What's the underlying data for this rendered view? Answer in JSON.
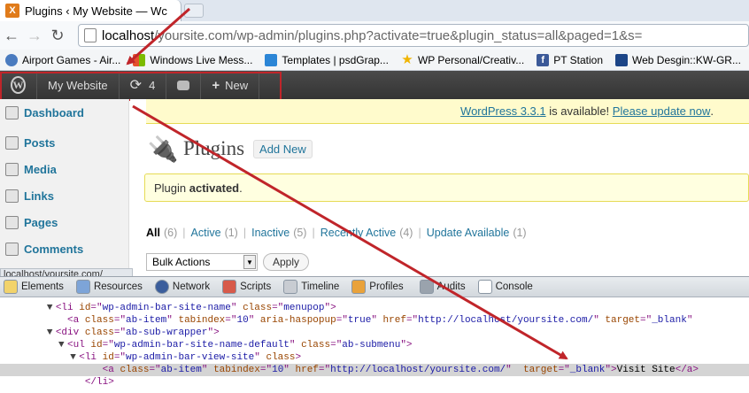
{
  "browser": {
    "tab_title": "Plugins ‹ My Website — Wc",
    "tab_favicon_glyph": "X",
    "url_host": "localhost",
    "url_path": "/yoursite.com/wp-admin/plugins.php?activate=true&plugin_status=all&paged=1&s=",
    "bookmarks": [
      {
        "label": "Airport Games - Air...",
        "icon": "globe-icon",
        "color": "#4a7bbf"
      },
      {
        "label": "Windows Live Mess...",
        "icon": "windows-icon",
        "color": "#e5512d"
      },
      {
        "label": "Templates | psdGrap...",
        "icon": "psd-icon",
        "color": "#2b85d6"
      },
      {
        "label": "WP Personal/Creativ...",
        "icon": "star-icon",
        "color": "#f0b400"
      },
      {
        "label": "PT Station",
        "icon": "facebook-icon",
        "color": "#3b5998"
      },
      {
        "label": "Web Desgin::KW-GR...",
        "icon": "kw-icon",
        "color": "#1c4587"
      }
    ],
    "status_url": "localhost/yoursite.com/"
  },
  "adminbar": {
    "site_name": "My Website",
    "updates_count": "4",
    "new_label": "New"
  },
  "sidebar": {
    "items": [
      {
        "label": "Dashboard",
        "icon": "dashboard-icon"
      },
      {
        "label": "Posts",
        "icon": "pin-icon"
      },
      {
        "label": "Media",
        "icon": "media-icon"
      },
      {
        "label": "Links",
        "icon": "link-icon"
      },
      {
        "label": "Pages",
        "icon": "pages-icon"
      },
      {
        "label": "Comments",
        "icon": "comments-icon"
      }
    ]
  },
  "content": {
    "update_link": "WordPress 3.3.1",
    "update_text": " is available! ",
    "update_now": "Please update now",
    "update_end": ".",
    "page_title": "Plugins",
    "add_new": "Add New",
    "notice_prefix": "Plugin ",
    "notice_bold": "activated",
    "notice_suffix": ".",
    "filters": [
      {
        "label": "All",
        "count": "(6)"
      },
      {
        "label": "Active",
        "count": "(1)"
      },
      {
        "label": "Inactive",
        "count": "(5)"
      },
      {
        "label": "Recently Active",
        "count": "(4)"
      },
      {
        "label": "Update Available",
        "count": "(1)"
      }
    ],
    "bulk_actions": "Bulk Actions",
    "apply": "Apply"
  },
  "devtools": {
    "tabs": [
      "Elements",
      "Resources",
      "Network",
      "Scripts",
      "Timeline",
      "Profiles",
      "Audits",
      "Console"
    ],
    "lines": [
      {
        "indent": "        ",
        "tri": "▼",
        "parts": [
          [
            "tag",
            "<li "
          ],
          [
            "an",
            "id"
          ],
          [
            "tag",
            "=\""
          ],
          [
            "av",
            "wp-admin-bar-site-name"
          ],
          [
            "tag",
            "\" "
          ],
          [
            "an",
            "class"
          ],
          [
            "tag",
            "=\""
          ],
          [
            "av",
            "menupop"
          ],
          [
            "tag",
            "\">"
          ]
        ]
      },
      {
        "indent": "          ",
        "tri": " ",
        "parts": [
          [
            "tag",
            "<a "
          ],
          [
            "an",
            "class"
          ],
          [
            "tag",
            "=\""
          ],
          [
            "av",
            "ab-item"
          ],
          [
            "tag",
            "\" "
          ],
          [
            "an",
            "tabindex"
          ],
          [
            "tag",
            "=\""
          ],
          [
            "av",
            "10"
          ],
          [
            "tag",
            "\" "
          ],
          [
            "an",
            "aria-haspopup"
          ],
          [
            "tag",
            "=\""
          ],
          [
            "av",
            "true"
          ],
          [
            "tag",
            "\" "
          ],
          [
            "an",
            "href"
          ],
          [
            "tag",
            "=\""
          ],
          [
            "av",
            "http://localhost/yoursite.com/"
          ],
          [
            "tag",
            "\" "
          ],
          [
            "an",
            "target"
          ],
          [
            "tag",
            "=\""
          ],
          [
            "av",
            "_blank"
          ],
          [
            "tag",
            "\""
          ]
        ]
      },
      {
        "indent": "        ",
        "tri": "▼",
        "parts": [
          [
            "tag",
            "<div "
          ],
          [
            "an",
            "class"
          ],
          [
            "tag",
            "=\""
          ],
          [
            "av",
            "ab-sub-wrapper"
          ],
          [
            "tag",
            "\">"
          ]
        ]
      },
      {
        "indent": "          ",
        "tri": "▼",
        "parts": [
          [
            "tag",
            "<ul "
          ],
          [
            "an",
            "id"
          ],
          [
            "tag",
            "=\""
          ],
          [
            "av",
            "wp-admin-bar-site-name-default"
          ],
          [
            "tag",
            "\" "
          ],
          [
            "an",
            "class"
          ],
          [
            "tag",
            "=\""
          ],
          [
            "av",
            "ab-submenu"
          ],
          [
            "tag",
            "\">"
          ]
        ]
      },
      {
        "indent": "            ",
        "tri": "▼",
        "parts": [
          [
            "tag",
            "<li "
          ],
          [
            "an",
            "id"
          ],
          [
            "tag",
            "=\""
          ],
          [
            "av",
            "wp-admin-bar-view-site"
          ],
          [
            "tag",
            "\" "
          ],
          [
            "an",
            "class"
          ],
          [
            "tag",
            ">"
          ]
        ]
      },
      {
        "indent": "                ",
        "tri": " ",
        "parts": [
          [
            "tag",
            "<a "
          ],
          [
            "an",
            "class"
          ],
          [
            "tag",
            "=\""
          ],
          [
            "av",
            "ab-item"
          ],
          [
            "tag",
            "\" "
          ],
          [
            "an",
            "tabindex"
          ],
          [
            "tag",
            "=\""
          ],
          [
            "av",
            "10"
          ],
          [
            "tag",
            "\" "
          ],
          [
            "an",
            "href"
          ],
          [
            "tag",
            "=\""
          ],
          [
            "av",
            "http://localhost/yoursite.com/"
          ],
          [
            "tag",
            "\"  "
          ],
          [
            "an",
            "target"
          ],
          [
            "tag",
            "=\""
          ],
          [
            "av",
            "_blank"
          ],
          [
            "tag",
            "\">"
          ],
          [
            "txt",
            "Visit Site"
          ],
          [
            "tag",
            "</a>"
          ]
        ]
      },
      {
        "indent": "             ",
        "tri": " ",
        "parts": [
          [
            "tag",
            "</li>"
          ]
        ]
      }
    ]
  },
  "colors": {
    "annotation_red": "#c0252a",
    "wp_link": "#21759b"
  }
}
